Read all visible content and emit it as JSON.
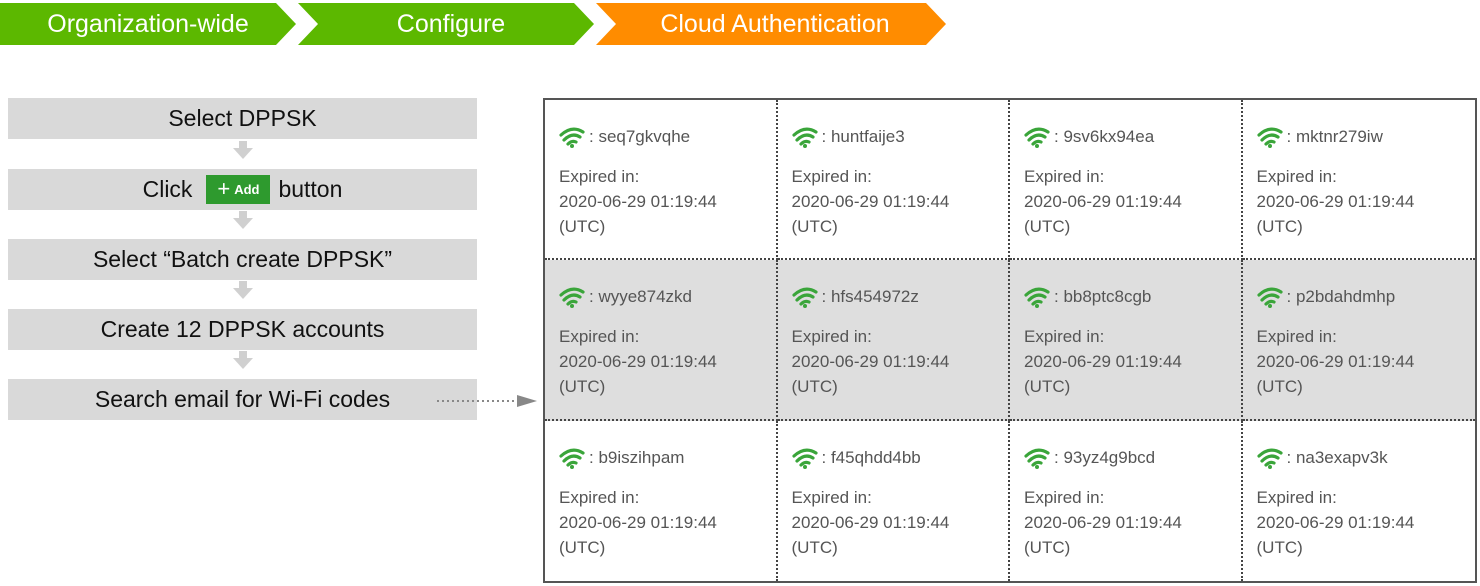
{
  "breadcrumb": {
    "items": [
      {
        "label": "Organization-wide",
        "color": "#5cb800"
      },
      {
        "label": "Configure",
        "color": "#5cb800"
      },
      {
        "label": "Cloud Authentication",
        "color": "#ff8c00"
      }
    ]
  },
  "steps": {
    "select_dppsk": "Select DPPSK",
    "click_prefix": "Click",
    "add_button_plus": "+",
    "add_button_label": "Add",
    "click_suffix": "button",
    "batch_create": "Select “Batch create DPPSK”",
    "create_accounts": "Create 12 DPPSK accounts",
    "search_email": "Search email for Wi-Fi codes"
  },
  "accounts": [
    {
      "code": ": seq7gkvqhe",
      "expired_label": "Expired in:",
      "date": "2020-06-29 01:19:44",
      "tz": "(UTC)"
    },
    {
      "code": ": huntfaije3",
      "expired_label": "Expired in:",
      "date": "2020-06-29 01:19:44",
      "tz": "(UTC)"
    },
    {
      "code": ": 9sv6kx94ea",
      "expired_label": "Expired in:",
      "date": "2020-06-29 01:19:44",
      "tz": "(UTC)"
    },
    {
      "code": ": mktnr279iw",
      "expired_label": "Expired in:",
      "date": "2020-06-29 01:19:44",
      "tz": "(UTC)"
    },
    {
      "code": ": wyye874zkd",
      "expired_label": "Expired in:",
      "date": "2020-06-29 01:19:44",
      "tz": "(UTC)"
    },
    {
      "code": ": hfs454972z",
      "expired_label": "Expired in:",
      "date": "2020-06-29 01:19:44",
      "tz": "(UTC)"
    },
    {
      "code": ": bb8ptc8cgb",
      "expired_label": "Expired in:",
      "date": "2020-06-29 01:19:44",
      "tz": "(UTC)"
    },
    {
      "code": ": p2bdahdmhp",
      "expired_label": "Expired in:",
      "date": "2020-06-29 01:19:44",
      "tz": "(UTC)"
    },
    {
      "code": ": b9iszihpam",
      "expired_label": "Expired in:",
      "date": "2020-06-29 01:19:44",
      "tz": "(UTC)"
    },
    {
      "code": ": f45qhdd4bb",
      "expired_label": "Expired in:",
      "date": "2020-06-29 01:19:44",
      "tz": "(UTC)"
    },
    {
      "code": ": 93yz4g9bcd",
      "expired_label": "Expired in:",
      "date": "2020-06-29 01:19:44",
      "tz": "(UTC)"
    },
    {
      "code": ": na3exapv3k",
      "expired_label": "Expired in:",
      "date": "2020-06-29 01:19:44",
      "tz": "(UTC)"
    }
  ],
  "colors": {
    "wifi_icon": "#3aa53a",
    "step_bg": "#d9d9d9",
    "shaded_row": "#dedede",
    "arrow": "#d0d0d0"
  },
  "icons": {
    "account": "wifi-icon",
    "flow": "chevron-down-arrow",
    "link": "dotted-right-arrow"
  }
}
